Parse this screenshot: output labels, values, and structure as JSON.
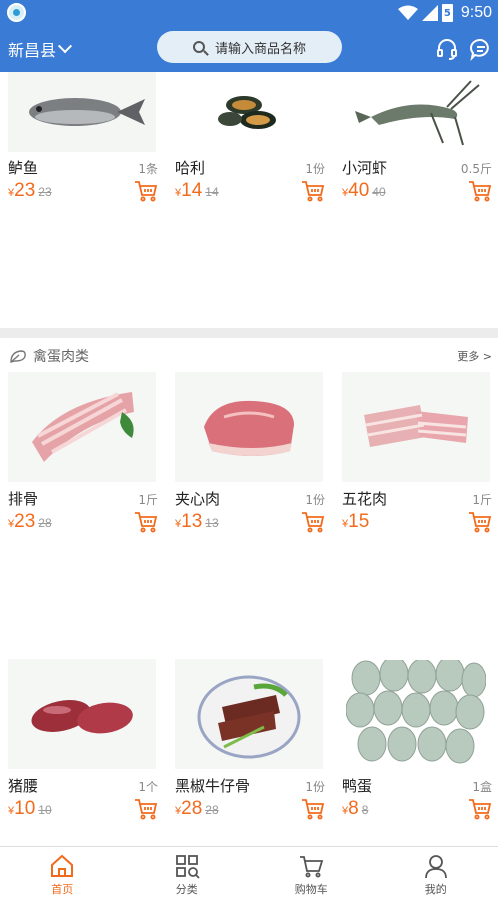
{
  "status_bar": {
    "time": "9:50",
    "battery_glyph": "5"
  },
  "header": {
    "location": "新昌县",
    "search_placeholder": "请输入商品名称"
  },
  "top_products": [
    {
      "name": "鲈鱼",
      "unit": "1条",
      "price": "23",
      "old_price": "23",
      "image": "fish"
    },
    {
      "name": "哈利",
      "unit": "1份",
      "price": "14",
      "old_price": "14",
      "image": "mussels"
    },
    {
      "name": "小河虾",
      "unit": "0.5斤",
      "price": "40",
      "old_price": "40",
      "image": "shrimp"
    }
  ],
  "section_meat": {
    "title": "禽蛋肉类",
    "more": "更多 >",
    "icon": "leaf-icon",
    "products": [
      {
        "name": "排骨",
        "unit": "1斤",
        "price": "23",
        "old_price": "28",
        "image": "ribs"
      },
      {
        "name": "夹心肉",
        "unit": "1份",
        "price": "13",
        "old_price": "13",
        "image": "pork-shoulder"
      },
      {
        "name": "五花肉",
        "unit": "1斤",
        "price": "15",
        "old_price": "",
        "image": "pork-belly"
      },
      {
        "name": "猪腰",
        "unit": "1个",
        "price": "10",
        "old_price": "10",
        "image": "kidney"
      },
      {
        "name": "黑椒牛仔骨",
        "unit": "1份",
        "price": "28",
        "old_price": "28",
        "image": "beef-ribs"
      },
      {
        "name": "鸭蛋",
        "unit": "1盒",
        "price": "8",
        "old_price": "8",
        "image": "duck-eggs"
      }
    ]
  },
  "currency_symbol": "¥",
  "tabs": [
    {
      "label": "首页",
      "icon": "home-icon",
      "active": true
    },
    {
      "label": "分类",
      "icon": "category-icon",
      "active": false
    },
    {
      "label": "购物车",
      "icon": "cart-icon",
      "active": false
    },
    {
      "label": "我的",
      "icon": "user-icon",
      "active": false
    }
  ],
  "colors": {
    "primary": "#3a7bd5",
    "accent": "#f26b1d"
  }
}
